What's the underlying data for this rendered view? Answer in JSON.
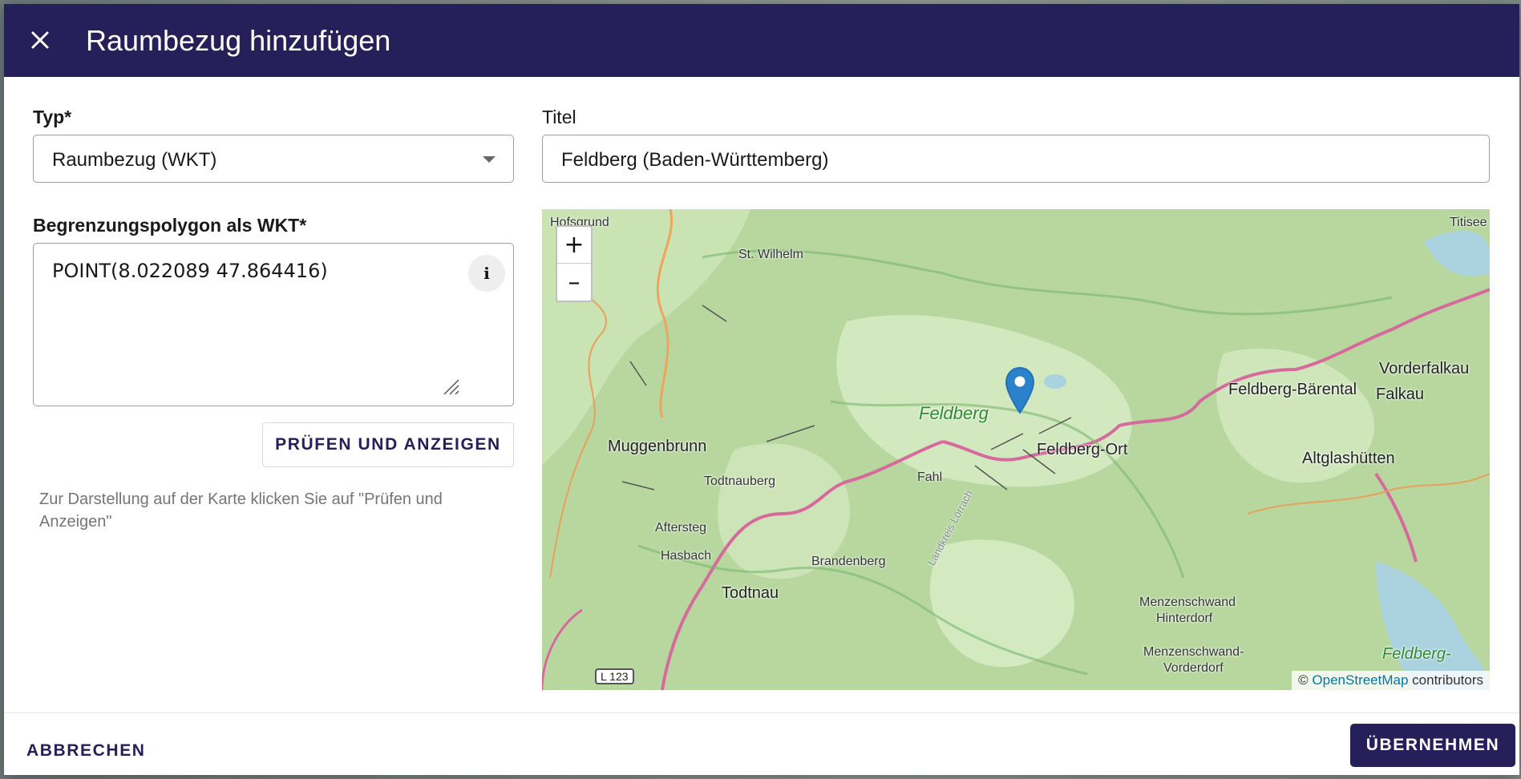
{
  "dialog": {
    "title": "Raumbezug hinzufügen"
  },
  "form": {
    "type_label": "Typ*",
    "type_value": "Raumbezug (WKT)",
    "title_label": "Titel",
    "title_value": "Feldberg (Baden-Württemberg)",
    "wkt_label": "Begrenzungspolygon als WKT*",
    "wkt_value": "POINT(8.022089 47.864416)",
    "info_label": "i",
    "check_button": "PRÜFEN UND ANZEIGEN",
    "hint": "Zur Darstellung auf der Karte klicken Sie auf \"Prüfen und Anzeigen\""
  },
  "map": {
    "zoom_in": "+",
    "zoom_out": "–",
    "attribution_prefix": "©",
    "attribution_link": "OpenStreetMap",
    "attribution_suffix": "contributors",
    "road_label": "L 123",
    "places": {
      "hofsgrund": "Hofsgrund",
      "st_wilhelm": "St. Wilhelm",
      "titisee": "Titisee",
      "vorderfalkau": "Vorderfalkau",
      "feldberg_barental": "Feldberg-Bärental",
      "falkau": "Falkau",
      "feldberg": "Feldberg",
      "feldberg_ort": "Feldberg-Ort",
      "altglashuetten": "Altglashütten",
      "muggenbrunn": "Muggenbrunn",
      "fahl": "Fahl",
      "todtnauberg": "Todtnauberg",
      "aftersteg": "Aftersteg",
      "hasbach": "Hasbach",
      "brandenberg": "Brandenberg",
      "todtnau": "Todtnau",
      "landkreis": "Landkreis Lörrach",
      "menzenschwand_hinterdorf_1": "Menzenschwand",
      "menzenschwand_hinterdorf_2": "Hinterdorf",
      "menzenschwand_vorderdorf_1": "Menzenschwand-",
      "menzenschwand_vorderdorf_2": "Vorderdorf",
      "feldberg_schluchsee": "Feldberg-"
    }
  },
  "footer": {
    "cancel": "ABBRECHEN",
    "apply": "ÜBERNEHMEN"
  },
  "colors": {
    "primary": "#26205a",
    "map_green": "#b7d79f",
    "marker": "#2b82cb"
  }
}
